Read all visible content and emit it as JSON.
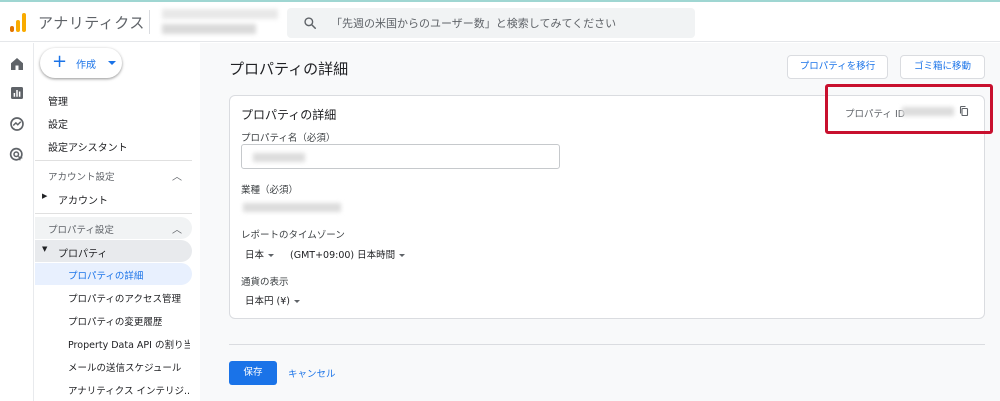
{
  "app": {
    "title": "アナリティクス",
    "brand_colors": [
      "#f9ab00",
      "#e37400"
    ]
  },
  "search": {
    "placeholder": "「先週の米国からのユーザー数」と検索してみてください"
  },
  "rail": {
    "icons": [
      "home-icon",
      "reports-icon",
      "explore-icon",
      "advertising-icon"
    ]
  },
  "sidebar": {
    "create_label": "作成",
    "links": [
      "管理",
      "設定",
      "設定アシスタント"
    ],
    "account_section": {
      "title": "アカウント設定",
      "item": "アカウント"
    },
    "property_section": {
      "title": "プロパティ設定",
      "item": "プロパティ",
      "subitems": [
        "プロパティの詳細",
        "プロパティのアクセス管理",
        "プロパティの変更履歴",
        "Property Data API の割り当...",
        "メールの送信スケジュール",
        "アナリティクス インテリジ..."
      ],
      "active_index": 0
    }
  },
  "main": {
    "page_title": "プロパティの詳細",
    "move_button": "プロパティを移行",
    "trash_button": "ゴミ箱に移動",
    "card": {
      "title": "プロパティの詳細",
      "property_id_label": "プロパティ ID",
      "name_label": "プロパティ名（必須）",
      "industry_label": "業種（必須）",
      "timezone_label": "レポートのタイムゾーン",
      "timezone_country": "日本",
      "timezone_value": "(GMT+09:00) 日本時間",
      "currency_label": "通貨の表示",
      "currency_value": "日本円 (¥)"
    },
    "save_button": "保存",
    "cancel_link": "キャンセル"
  },
  "colors": {
    "accent": "#1a73e8",
    "highlight": "#c8102e",
    "active_bg": "#e8f0fe",
    "section_bg": "#f1f3f4"
  }
}
